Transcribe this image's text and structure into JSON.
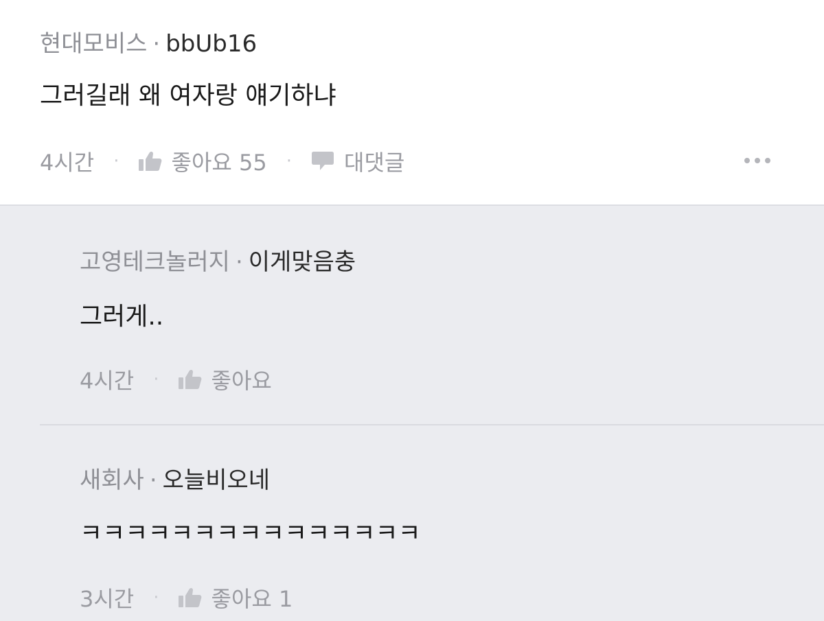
{
  "comment": {
    "company": "현대모비스",
    "separator": "·",
    "nickname": "bbUb16",
    "text": "그러길래 왜 여자랑 얘기하냐",
    "time": "4시간",
    "like_label": "좋아요 55",
    "reply_label": "대댓글",
    "icons": [
      "thumbs-up-icon",
      "speech-bubble-icon",
      "more-icon"
    ]
  },
  "replies": [
    {
      "company": "고영테크놀러지",
      "separator": "·",
      "nickname": "이게맞음충",
      "text": "그러게..",
      "time": "4시간",
      "like_label": "좋아요"
    },
    {
      "company": "새회사",
      "separator": "·",
      "nickname": "오늘비오네",
      "text": "ㅋㅋㅋㅋㅋㅋㅋㅋㅋㅋㅋㅋㅋㅋㅋ",
      "time": "3시간",
      "like_label": "좋아요 1"
    }
  ],
  "colors": {
    "reply_background": "#ebecf0",
    "muted_text": "#9a9ba1",
    "icon_gray": "#c3c4c9"
  }
}
